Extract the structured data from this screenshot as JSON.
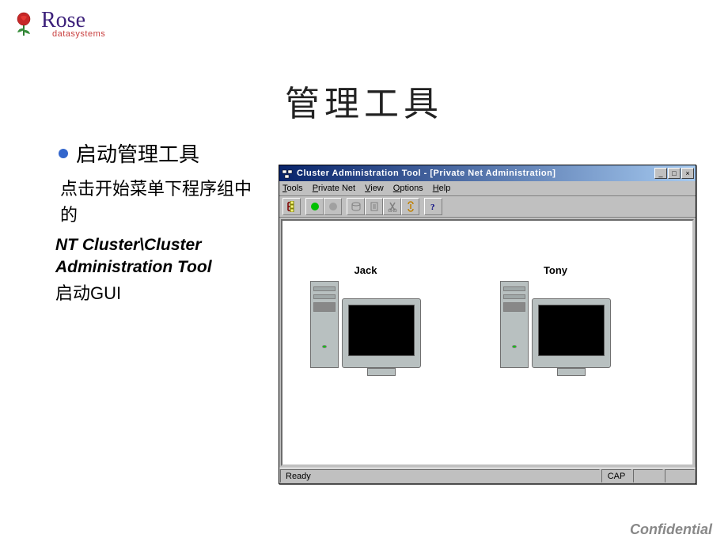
{
  "logo": {
    "main": "Rose",
    "sub": "datasystems"
  },
  "slide": {
    "title": "管理工具",
    "bullet": "启动管理工具",
    "desc1": "点击开始菜单下程序组中的",
    "desc2": "NT Cluster\\Cluster Administration Tool",
    "desc3_prefix": "启动",
    "desc3_gui": "GUI"
  },
  "window": {
    "title": "Cluster Administration Tool - [Private Net Administration]",
    "menus": {
      "tools": "Tools",
      "private_net": "Private Net",
      "view": "View",
      "options": "Options",
      "help": "Help"
    },
    "toolbar_icons": {
      "t1": "tree-icon",
      "t2": "green-circle-icon",
      "t3": "gray-circle-icon",
      "t4": "disk-icon",
      "t5": "doc-icon",
      "t6": "scissors-icon",
      "t7": "link-icon",
      "t8": "help-icon"
    },
    "nodes": {
      "node1": "Jack",
      "node2": "Tony"
    },
    "status": {
      "ready": "Ready",
      "cap": "CAP"
    }
  },
  "footer": {
    "confidential": "Confidential"
  }
}
